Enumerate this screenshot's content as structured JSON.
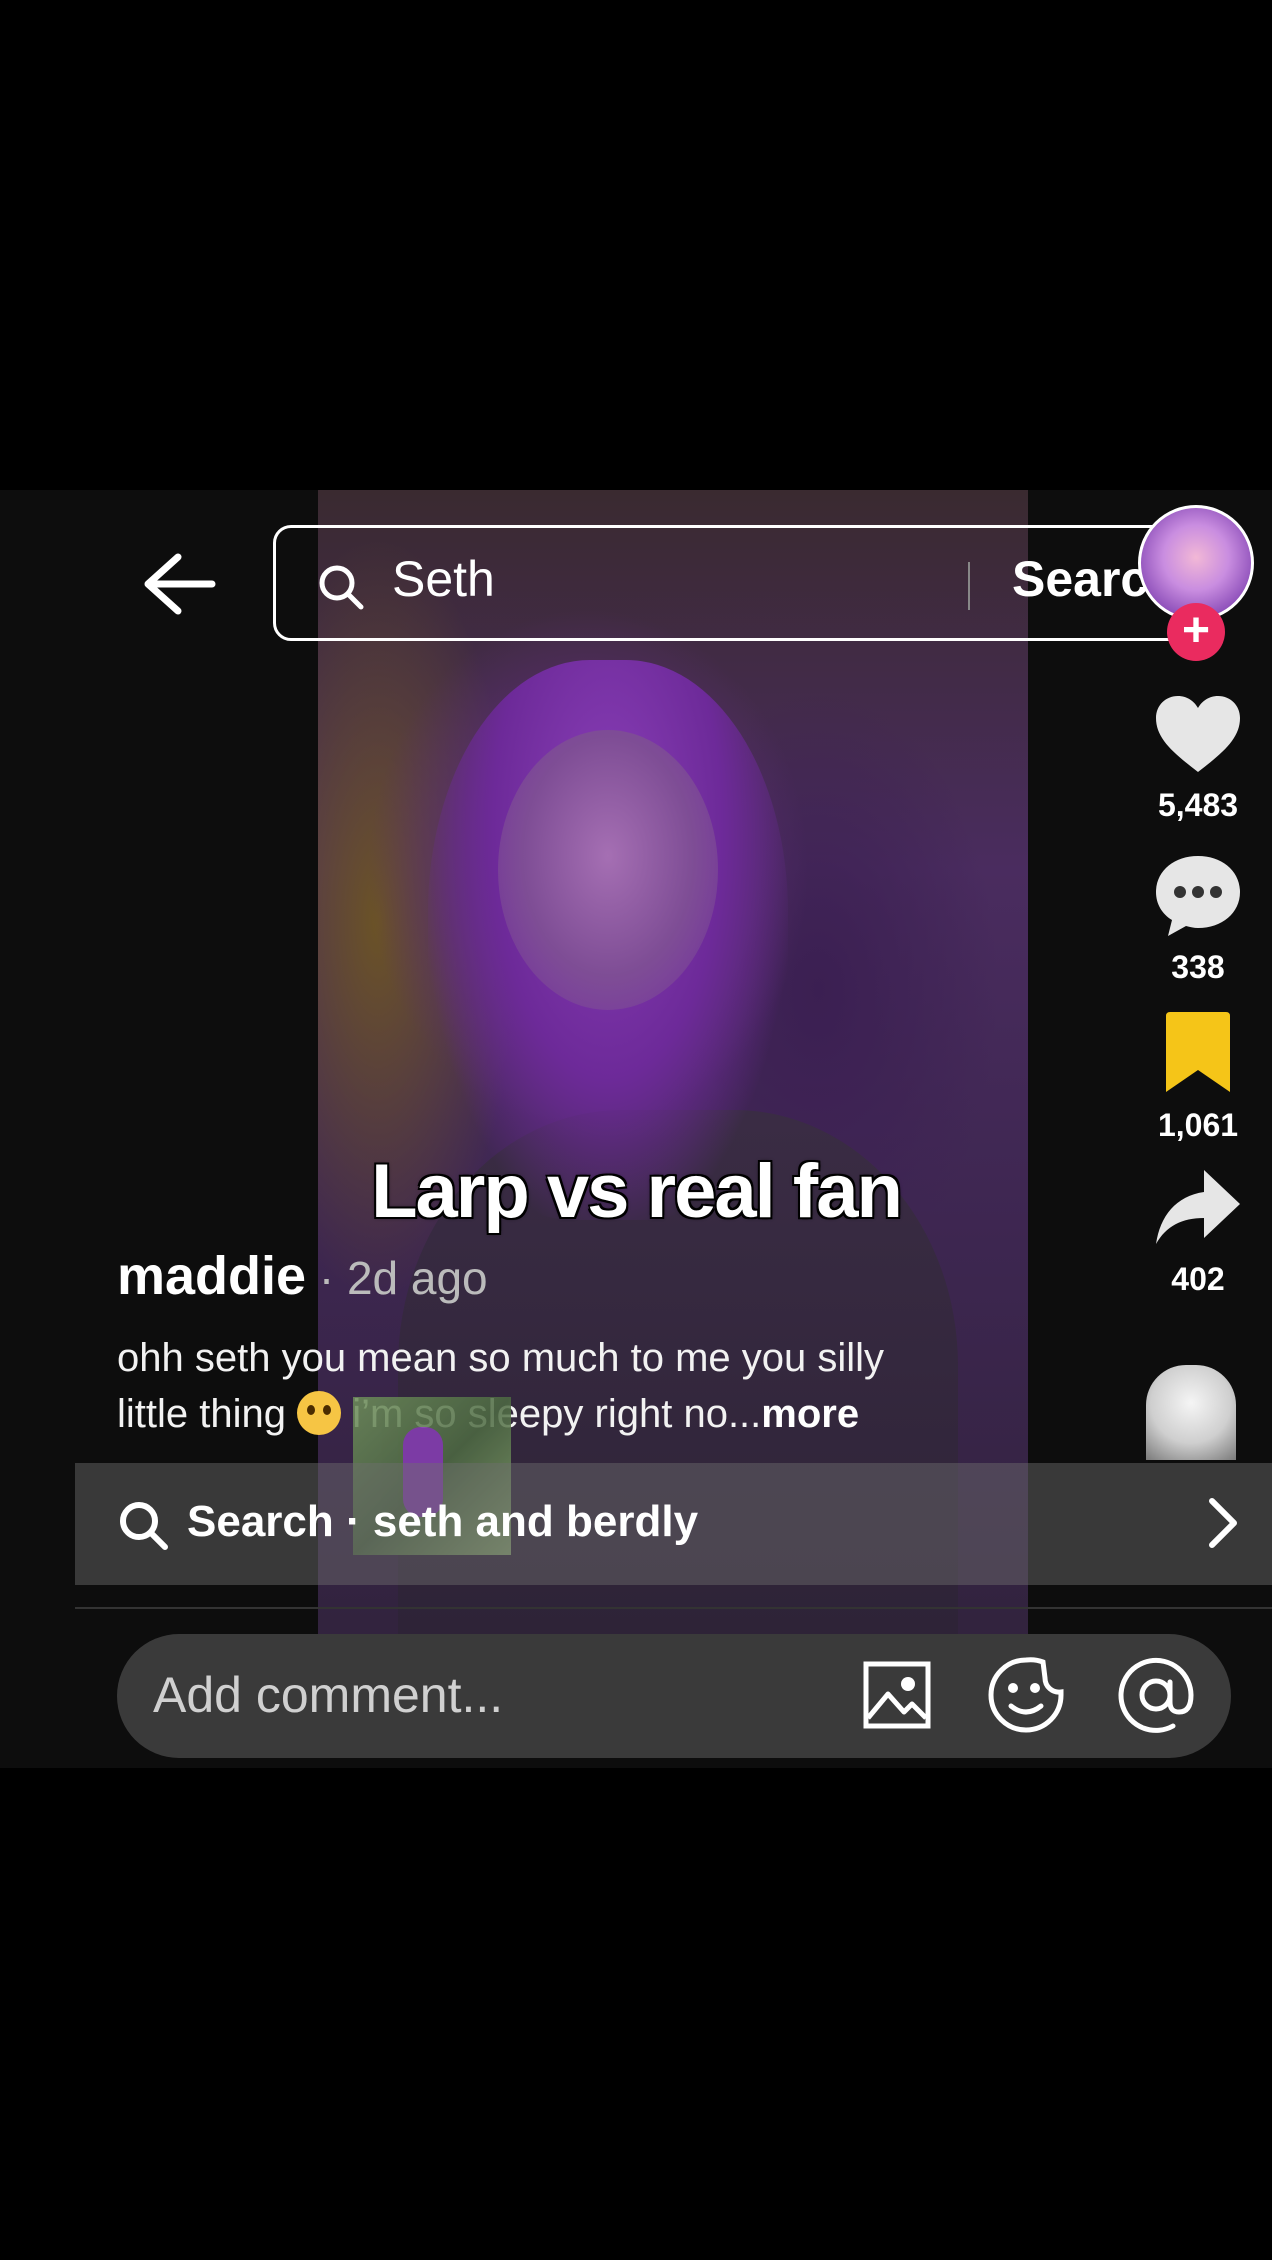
{
  "search": {
    "query": "Seth",
    "button_label": "Search"
  },
  "video": {
    "overlay_text": "Larp vs real fan"
  },
  "actions": {
    "likes": "5,483",
    "comments": "338",
    "saves": "1,061",
    "shares": "402"
  },
  "post": {
    "username": "maddie",
    "time": " · 2d ago",
    "description_1": "ohh seth you mean so much to me you silly",
    "description_2a": "little thing ",
    "description_2b": " i’m so sleepy right no...",
    "more_label": "more"
  },
  "suggestion": {
    "label": "Search · seth and berdly"
  },
  "comment_bar": {
    "placeholder": "Add comment..."
  },
  "icons": [
    "back-arrow-icon",
    "search-icon",
    "heart-icon",
    "comment-icon",
    "bookmark-icon",
    "share-icon",
    "chevron-right-icon",
    "image-icon",
    "sticker-icon",
    "mention-icon",
    "plus-icon"
  ],
  "colors": {
    "follow_plus": "#ea2b5f",
    "bookmark_active": "#f5c518"
  }
}
